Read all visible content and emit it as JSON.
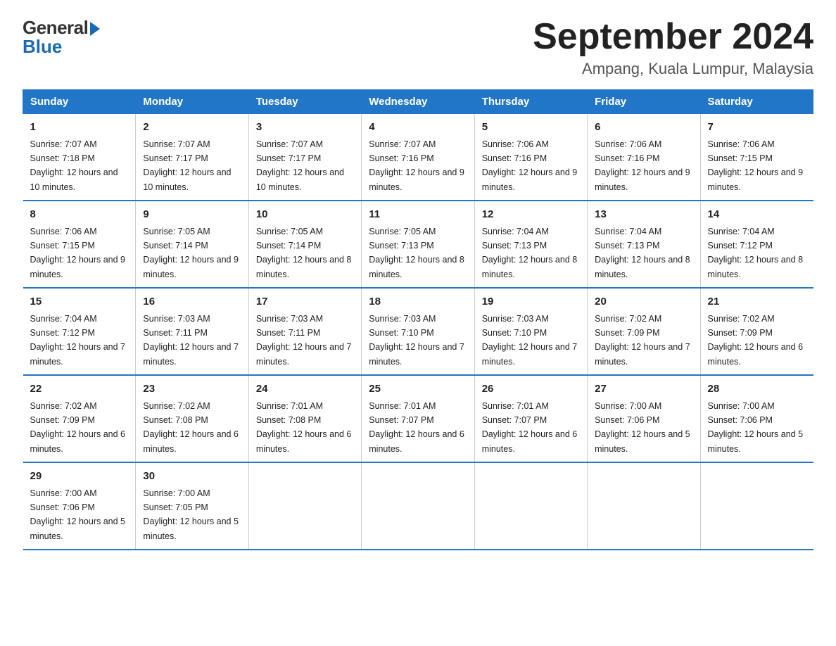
{
  "header": {
    "logo_general": "General",
    "logo_blue": "Blue",
    "month_title": "September 2024",
    "location": "Ampang, Kuala Lumpur, Malaysia"
  },
  "days_of_week": [
    "Sunday",
    "Monday",
    "Tuesday",
    "Wednesday",
    "Thursday",
    "Friday",
    "Saturday"
  ],
  "weeks": [
    [
      {
        "day": "1",
        "sunrise": "7:07 AM",
        "sunset": "7:18 PM",
        "daylight": "12 hours and 10 minutes."
      },
      {
        "day": "2",
        "sunrise": "7:07 AM",
        "sunset": "7:17 PM",
        "daylight": "12 hours and 10 minutes."
      },
      {
        "day": "3",
        "sunrise": "7:07 AM",
        "sunset": "7:17 PM",
        "daylight": "12 hours and 10 minutes."
      },
      {
        "day": "4",
        "sunrise": "7:07 AM",
        "sunset": "7:16 PM",
        "daylight": "12 hours and 9 minutes."
      },
      {
        "day": "5",
        "sunrise": "7:06 AM",
        "sunset": "7:16 PM",
        "daylight": "12 hours and 9 minutes."
      },
      {
        "day": "6",
        "sunrise": "7:06 AM",
        "sunset": "7:16 PM",
        "daylight": "12 hours and 9 minutes."
      },
      {
        "day": "7",
        "sunrise": "7:06 AM",
        "sunset": "7:15 PM",
        "daylight": "12 hours and 9 minutes."
      }
    ],
    [
      {
        "day": "8",
        "sunrise": "7:06 AM",
        "sunset": "7:15 PM",
        "daylight": "12 hours and 9 minutes."
      },
      {
        "day": "9",
        "sunrise": "7:05 AM",
        "sunset": "7:14 PM",
        "daylight": "12 hours and 9 minutes."
      },
      {
        "day": "10",
        "sunrise": "7:05 AM",
        "sunset": "7:14 PM",
        "daylight": "12 hours and 8 minutes."
      },
      {
        "day": "11",
        "sunrise": "7:05 AM",
        "sunset": "7:13 PM",
        "daylight": "12 hours and 8 minutes."
      },
      {
        "day": "12",
        "sunrise": "7:04 AM",
        "sunset": "7:13 PM",
        "daylight": "12 hours and 8 minutes."
      },
      {
        "day": "13",
        "sunrise": "7:04 AM",
        "sunset": "7:13 PM",
        "daylight": "12 hours and 8 minutes."
      },
      {
        "day": "14",
        "sunrise": "7:04 AM",
        "sunset": "7:12 PM",
        "daylight": "12 hours and 8 minutes."
      }
    ],
    [
      {
        "day": "15",
        "sunrise": "7:04 AM",
        "sunset": "7:12 PM",
        "daylight": "12 hours and 7 minutes."
      },
      {
        "day": "16",
        "sunrise": "7:03 AM",
        "sunset": "7:11 PM",
        "daylight": "12 hours and 7 minutes."
      },
      {
        "day": "17",
        "sunrise": "7:03 AM",
        "sunset": "7:11 PM",
        "daylight": "12 hours and 7 minutes."
      },
      {
        "day": "18",
        "sunrise": "7:03 AM",
        "sunset": "7:10 PM",
        "daylight": "12 hours and 7 minutes."
      },
      {
        "day": "19",
        "sunrise": "7:03 AM",
        "sunset": "7:10 PM",
        "daylight": "12 hours and 7 minutes."
      },
      {
        "day": "20",
        "sunrise": "7:02 AM",
        "sunset": "7:09 PM",
        "daylight": "12 hours and 7 minutes."
      },
      {
        "day": "21",
        "sunrise": "7:02 AM",
        "sunset": "7:09 PM",
        "daylight": "12 hours and 6 minutes."
      }
    ],
    [
      {
        "day": "22",
        "sunrise": "7:02 AM",
        "sunset": "7:09 PM",
        "daylight": "12 hours and 6 minutes."
      },
      {
        "day": "23",
        "sunrise": "7:02 AM",
        "sunset": "7:08 PM",
        "daylight": "12 hours and 6 minutes."
      },
      {
        "day": "24",
        "sunrise": "7:01 AM",
        "sunset": "7:08 PM",
        "daylight": "12 hours and 6 minutes."
      },
      {
        "day": "25",
        "sunrise": "7:01 AM",
        "sunset": "7:07 PM",
        "daylight": "12 hours and 6 minutes."
      },
      {
        "day": "26",
        "sunrise": "7:01 AM",
        "sunset": "7:07 PM",
        "daylight": "12 hours and 6 minutes."
      },
      {
        "day": "27",
        "sunrise": "7:00 AM",
        "sunset": "7:06 PM",
        "daylight": "12 hours and 5 minutes."
      },
      {
        "day": "28",
        "sunrise": "7:00 AM",
        "sunset": "7:06 PM",
        "daylight": "12 hours and 5 minutes."
      }
    ],
    [
      {
        "day": "29",
        "sunrise": "7:00 AM",
        "sunset": "7:06 PM",
        "daylight": "12 hours and 5 minutes."
      },
      {
        "day": "30",
        "sunrise": "7:00 AM",
        "sunset": "7:05 PM",
        "daylight": "12 hours and 5 minutes."
      },
      {
        "day": "",
        "sunrise": "",
        "sunset": "",
        "daylight": ""
      },
      {
        "day": "",
        "sunrise": "",
        "sunset": "",
        "daylight": ""
      },
      {
        "day": "",
        "sunrise": "",
        "sunset": "",
        "daylight": ""
      },
      {
        "day": "",
        "sunrise": "",
        "sunset": "",
        "daylight": ""
      },
      {
        "day": "",
        "sunrise": "",
        "sunset": "",
        "daylight": ""
      }
    ]
  ]
}
